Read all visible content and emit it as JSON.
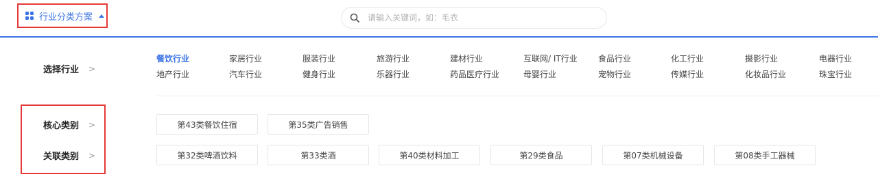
{
  "header": {
    "scheme_label": "行业分类方案",
    "search_placeholder": "请输入关键词，如：毛衣",
    "accent_color": "#3b73e6"
  },
  "industry": {
    "label": "选择行业",
    "items": [
      {
        "label": "餐饮行业",
        "active": true
      },
      {
        "label": "家居行业"
      },
      {
        "label": "服装行业"
      },
      {
        "label": "旅游行业"
      },
      {
        "label": "建材行业"
      },
      {
        "label": "互联网/ IT行业"
      },
      {
        "label": "食品行业"
      },
      {
        "label": "化工行业"
      },
      {
        "label": "摄影行业"
      },
      {
        "label": "电器行业"
      },
      {
        "label": "地产行业"
      },
      {
        "label": "汽车行业"
      },
      {
        "label": "健身行业"
      },
      {
        "label": "乐器行业"
      },
      {
        "label": "药品医疗行业"
      },
      {
        "label": "母婴行业"
      },
      {
        "label": "宠物行业"
      },
      {
        "label": "传媒行业"
      },
      {
        "label": "化妆品行业"
      },
      {
        "label": "珠宝行业"
      }
    ]
  },
  "core": {
    "label": "核心类别",
    "tags": [
      "第43类餐饮住宿",
      "第35类广告销售"
    ]
  },
  "related": {
    "label": "关联类别",
    "tags": [
      "第32类啤酒饮料",
      "第33类酒",
      "第40类材料加工",
      "第29类食品",
      "第07类机械设备",
      "第08类手工器械"
    ]
  },
  "highlight_color": "#e53935"
}
